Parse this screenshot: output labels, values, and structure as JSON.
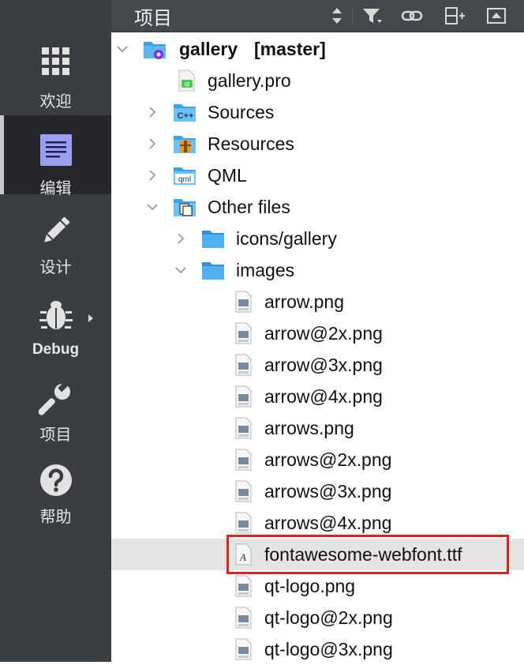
{
  "header": {
    "title": "项目"
  },
  "modes": [
    {
      "id": "welcome",
      "label": "欢迎",
      "icon": "grid-icon"
    },
    {
      "id": "edit",
      "label": "编辑",
      "icon": "edit-document-icon",
      "active": true
    },
    {
      "id": "design",
      "label": "设计",
      "icon": "pencil-icon"
    },
    {
      "id": "debug",
      "label": "Debug",
      "icon": "bug-icon"
    },
    {
      "id": "projects",
      "label": "项目",
      "icon": "wrench-icon"
    },
    {
      "id": "help",
      "label": "帮助",
      "icon": "help-icon"
    }
  ],
  "tree": {
    "project_name": "gallery",
    "branch": "[master]",
    "project_file": "gallery.pro",
    "sources": "Sources",
    "resources": "Resources",
    "qml": "QML",
    "other_files": "Other files",
    "icons_folder": "icons/gallery",
    "images_folder": "images",
    "files": [
      "arrow.png",
      "arrow@2x.png",
      "arrow@3x.png",
      "arrow@4x.png",
      "arrows.png",
      "arrows@2x.png",
      "arrows@3x.png",
      "arrows@4x.png",
      "fontawesome-webfont.ttf",
      "qt-logo.png",
      "qt-logo@2x.png",
      "qt-logo@3x.png"
    ]
  },
  "colors": {
    "highlight_border": "#d7261e",
    "folder_blue": "#3aa0e8",
    "qt_green": "#41cd52"
  }
}
